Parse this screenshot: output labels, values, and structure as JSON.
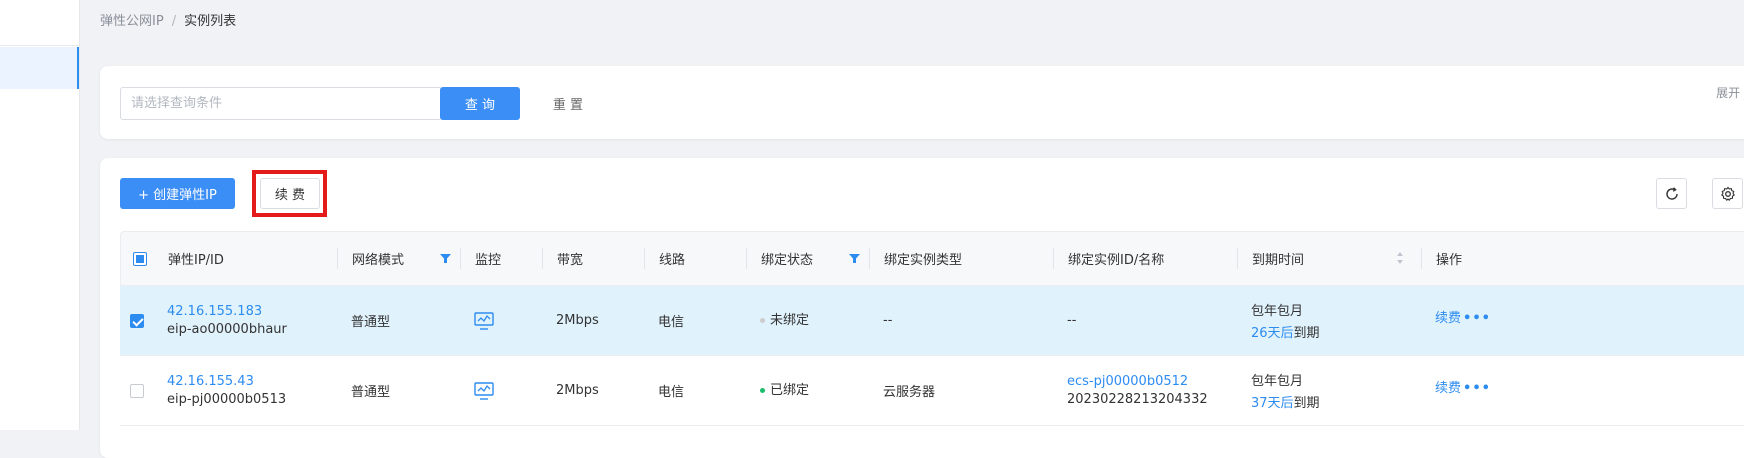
{
  "breadcrumb": {
    "parent": "弹性公网IP",
    "separator": "/",
    "current": "实例列表"
  },
  "filter": {
    "placeholder": "请选择查询条件",
    "query_label": "查 询",
    "reset_label": "重 置",
    "expand_label": "展开"
  },
  "toolbar": {
    "create_label": "+ 创建弹性IP",
    "renew_label": "续 费"
  },
  "table": {
    "headers": [
      "弹性IP/ID",
      "网络模式",
      "监控",
      "带宽",
      "线路",
      "绑定状态",
      "绑定实例类型",
      "绑定实例ID/名称",
      "到期时间",
      "操作"
    ],
    "rows": [
      {
        "ip": "42.16.155.183",
        "id": "eip-ao00000bhaur",
        "mode": "普通型",
        "bandwidth": "2Mbps",
        "line": "电信",
        "status": "未绑定",
        "instance_type": "--",
        "instance_id": "--",
        "instance_name": "",
        "billing": "包年包月",
        "expiry_days": "26天后",
        "expiry_suffix": "到期",
        "action": "续费",
        "more": "•••",
        "checked": true
      },
      {
        "ip": "42.16.155.43",
        "id": "eip-pj00000b0513",
        "mode": "普通型",
        "bandwidth": "2Mbps",
        "line": "电信",
        "status": "已绑定",
        "instance_type": "云服务器",
        "instance_id": "ecs-pj00000b0512",
        "instance_name": "20230228213204332",
        "billing": "包年包月",
        "expiry_days": "37天后",
        "expiry_suffix": "到期",
        "action": "续费",
        "more": "•••",
        "checked": false
      }
    ]
  },
  "colors": {
    "primary": "#3a8ef6",
    "link": "#2d8cf0",
    "highlight": "#e51b1b",
    "bound": "#19be6b",
    "unbound": "#cccccc",
    "selected_row": "#e0f2fc"
  }
}
